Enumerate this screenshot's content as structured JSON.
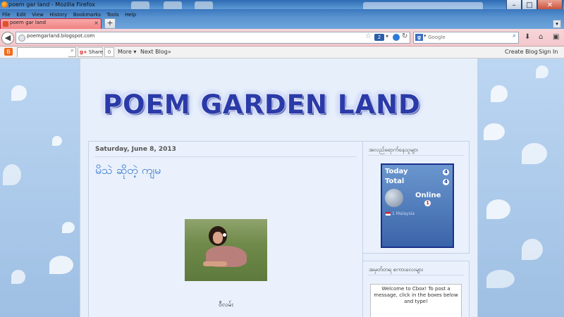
{
  "window": {
    "title": "poem gar land - Mozilla Firefox",
    "min": "–",
    "max": "□",
    "close": "✕"
  },
  "menubar": [
    "File",
    "Edit",
    "View",
    "History",
    "Bookmarks",
    "Tools",
    "Help"
  ],
  "tab": {
    "label": "poem gar land",
    "close": "×",
    "new_tab": "+"
  },
  "navbar": {
    "back": "◀",
    "url": "poemgarland.blogspot.com",
    "badge": "2",
    "search_engine": "g",
    "search_placeholder": "Google"
  },
  "blogger_bar": {
    "share_label": "Share",
    "share_count": "0",
    "more": "More ▾",
    "next_blog": "Next Blog»",
    "create_blog": "Create Blog",
    "sign_in": "Sign In"
  },
  "blog": {
    "title": "POEM GARDEN LAND"
  },
  "post": {
    "date": "Saturday, June 8, 2013",
    "title": "မိသဲ ဆိုတဲ့ ကျမ",
    "caption": "ဝီလမ်း"
  },
  "sidebar": {
    "widget1_title": "အလည်ရောက်နေသူများ",
    "counter": {
      "today_label": "Today",
      "today_value": "4",
      "total_label": "Total",
      "total_value": "4",
      "online_label": "Online",
      "online_value": "1",
      "visitor": "1 Malaysia"
    },
    "widget2_title": "အမှတ်တရ စကားလေးများ",
    "cbox_message": "Welcome to Cbox! To post a message, click in the boxes below and type!"
  }
}
